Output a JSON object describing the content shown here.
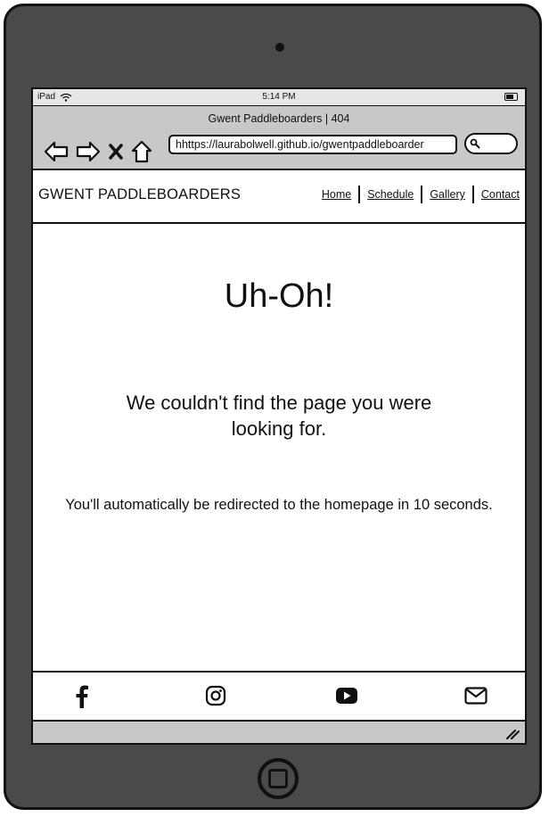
{
  "status_bar": {
    "device": "iPad",
    "time": "5:14 PM"
  },
  "browser": {
    "tab_title": "Gwent Paddleboarders | 404",
    "url": "hhttps://laurabolwell.github.io/gwentpaddleboarder"
  },
  "site": {
    "brand": "GWENT PADDLEBOARDERS",
    "nav": [
      "Home",
      "Schedule",
      "Gallery",
      "Contact"
    ]
  },
  "main": {
    "heading": "Uh-Oh!",
    "message": "We couldn't find the page you were looking for.",
    "redirect_note": "You'll automatically be redirected to the homepage in 10 seconds."
  },
  "footer": {
    "icons": [
      "facebook-icon",
      "instagram-icon",
      "youtube-icon",
      "envelope-icon"
    ]
  }
}
